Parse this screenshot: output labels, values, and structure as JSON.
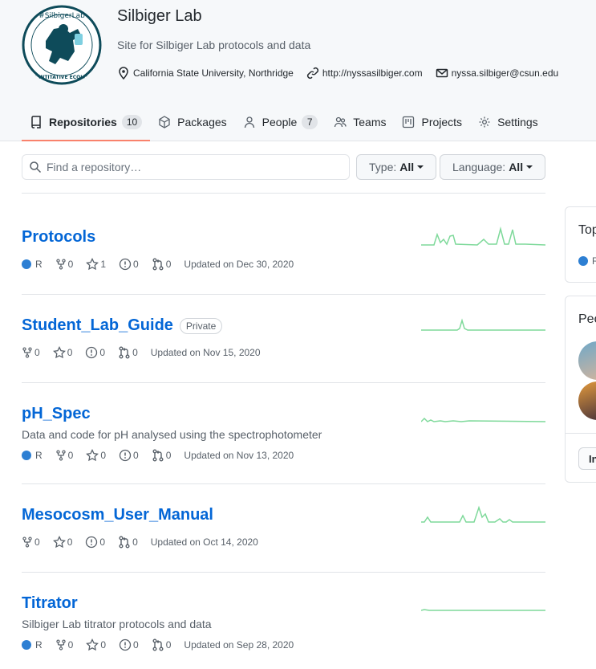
{
  "org": {
    "name": "Silbiger Lab",
    "description": "Site for Silbiger Lab protocols and data",
    "location": "California State University, Northridge",
    "website": "http://nyssasilbiger.com",
    "email": "nyssa.silbiger@csun.edu",
    "logo_text_top": "#SilbigerLab",
    "logo_text_bottom": "QUANTITATIVE ECOLOGY"
  },
  "tabs": [
    {
      "label": "Repositories",
      "count": "10",
      "icon": "repo-icon"
    },
    {
      "label": "Packages",
      "icon": "package-icon"
    },
    {
      "label": "People",
      "count": "7",
      "icon": "person-icon"
    },
    {
      "label": "Teams",
      "icon": "people-icon"
    },
    {
      "label": "Projects",
      "icon": "project-icon"
    },
    {
      "label": "Settings",
      "icon": "gear-icon"
    }
  ],
  "filters": {
    "search_placeholder": "Find a repository…",
    "type_label": "Type:",
    "type_value": "All",
    "language_label": "Language:",
    "language_value": "All"
  },
  "repos": [
    {
      "name": "Protocols",
      "language": "R",
      "forks": "0",
      "stars": "1",
      "issues": "0",
      "prs": "0",
      "updated": "Updated on Dec 30, 2020"
    },
    {
      "name": "Student_Lab_Guide",
      "badge": "Private",
      "forks": "0",
      "stars": "0",
      "issues": "0",
      "prs": "0",
      "updated": "Updated on Nov 15, 2020"
    },
    {
      "name": "pH_Spec",
      "description": "Data and code for pH analysed using the spectrophotometer",
      "language": "R",
      "forks": "0",
      "stars": "0",
      "issues": "0",
      "prs": "0",
      "updated": "Updated on Nov 13, 2020"
    },
    {
      "name": "Mesocosm_User_Manual",
      "forks": "0",
      "stars": "0",
      "issues": "0",
      "prs": "0",
      "updated": "Updated on Oct 14, 2020"
    },
    {
      "name": "Titrator",
      "description": "Silbiger Lab titrator protocols and data",
      "language": "R",
      "forks": "0",
      "stars": "0",
      "issues": "0",
      "prs": "0",
      "updated": "Updated on Sep 28, 2020"
    }
  ],
  "sidebar": {
    "top_languages_heading": "Top",
    "top_language_item": "R",
    "people_heading": "Peo",
    "invite_button": "In"
  },
  "colors": {
    "link": "#0366d6",
    "r_language": "#2d7fd3",
    "sparkline": "#7ed99a",
    "tab_underline": "#f9826c"
  }
}
